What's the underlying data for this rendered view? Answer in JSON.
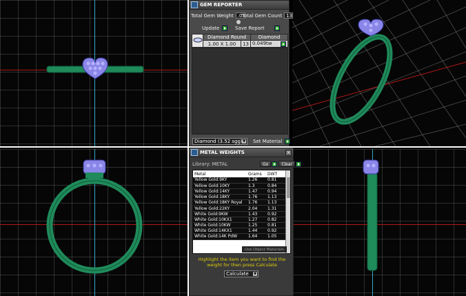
{
  "colors": {
    "ring_green": "#1f8a5a",
    "gem_purple": "#8a86e8",
    "axis_red": "#b01818",
    "axis_blue": "#3aa6c8",
    "hint_yellow": "#e3d10a"
  },
  "gem_reporter": {
    "title": "GEM REPORTER",
    "total_weight_label": "Total Gem Weight",
    "total_weight_value": ".05",
    "total_count_label": "Total Gem Count",
    "total_count_value": "13",
    "update_label": "Update",
    "save_report_label": "Save Report",
    "table_headers": [
      "Diamond Round",
      "Diamond"
    ],
    "table_row": {
      "size": "1.00 X 1.00",
      "count": "13",
      "weight": "0.049tw"
    },
    "material_select": "Diamond     (3.52 sgg)",
    "set_material_label": "Set Material"
  },
  "metal_weights": {
    "title": "METAL WEIGHTS",
    "library_label": "Library: METAL",
    "btn_new": "Go",
    "btn_clear": "Clear",
    "columns": [
      "Metal",
      "Grams",
      "DWT"
    ],
    "rows": [
      {
        "metal": "Yellow Gold:9KY",
        "grams": "1.26",
        "dwt": "0.81"
      },
      {
        "metal": "Yellow Gold:10KY",
        "grams": "1.3",
        "dwt": "0.84"
      },
      {
        "metal": "Yellow Gold:14KY",
        "grams": "1.47",
        "dwt": "0.94"
      },
      {
        "metal": "Yellow Gold:18KY",
        "grams": "1.76",
        "dwt": "1.13"
      },
      {
        "metal": "Yellow Gold:18KY Royal",
        "grams": "1.76",
        "dwt": "1.13"
      },
      {
        "metal": "Yellow Gold:22KY",
        "grams": "2.04",
        "dwt": "1.31"
      },
      {
        "metal": "White Gold:9KW",
        "grams": "1.43",
        "dwt": "0.92"
      },
      {
        "metal": "White Gold:10KX1",
        "grams": "1.27",
        "dwt": "0.82"
      },
      {
        "metal": "White Gold:10KW",
        "grams": "1.25",
        "dwt": "0.81"
      },
      {
        "metal": "White Gold:14KX1",
        "grams": "1.44",
        "dwt": "0.92"
      },
      {
        "metal": "White Gold:14K PdW",
        "grams": "1.64",
        "dwt": "1.05"
      }
    ],
    "use_object_materials": "Use Object Materials",
    "hint_text": "Highlight the item you want to find the weight for then press Calculate",
    "calculate_label": "Calculate"
  }
}
